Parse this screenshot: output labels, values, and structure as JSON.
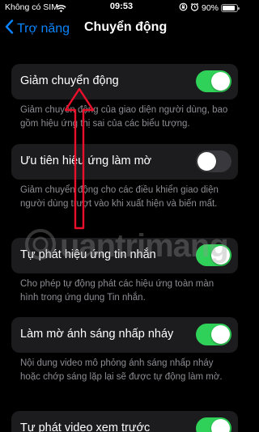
{
  "status_bar": {
    "carrier": "Không có SIM",
    "time": "09:53",
    "battery": "90%",
    "battery_level": 0.9
  },
  "nav": {
    "back_label": "Trợ năng",
    "title": "Chuyển động"
  },
  "settings": [
    {
      "label": "Giảm chuyển động",
      "on": true,
      "footer": "Giảm chuyển động của giao diện người dùng, bao gồm hiệu ứng thị sai của các biểu tượng."
    },
    {
      "label": "Ưu tiên hiệu ứng làm mờ",
      "on": false,
      "footer": "Giảm chuyển động cho các điều khiển giao diện người dùng trượt vào khi xuất hiện và biến mất."
    },
    {
      "label": "Tự phát hiệu ứng tin nhắn",
      "on": true,
      "footer": "Cho phép tự động phát các hiệu ứng toàn màn hình trong ứng dụng Tin nhắn."
    },
    {
      "label": "Làm mờ ánh sáng nhấp nháy",
      "on": true,
      "footer": "Nội dung video mô phỏng ánh sáng nhấp nháy hoặc chớp sáng lặp lại sẽ được tự động làm mờ."
    },
    {
      "label": "Tự phát video xem trước",
      "on": true,
      "footer": ""
    }
  ],
  "watermark": "uantrimang",
  "colors": {
    "accent": "#0a84ff",
    "toggle_on": "#30d158",
    "toggle_off": "#39393d",
    "group_bg": "#1c1c1e",
    "arrow": "#e8102a"
  },
  "icons": [
    "chevron-left-icon",
    "wifi-icon",
    "lock-rotation-icon",
    "alarm-icon",
    "battery-icon"
  ]
}
